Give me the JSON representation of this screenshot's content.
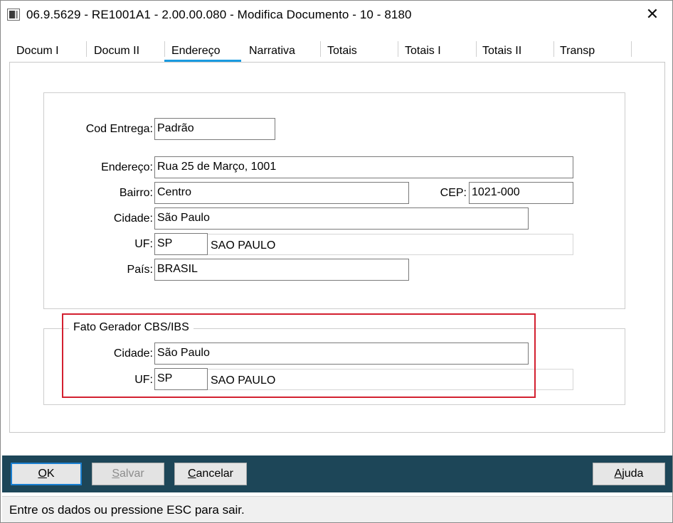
{
  "window": {
    "title": "06.9.5629 - RE1001A1 - 2.00.00.080 - Modifica Documento - 10 - 8180",
    "close_glyph": "✕",
    "icon": "app-window-icon"
  },
  "tabs": [
    {
      "label": "Docum I",
      "active": false
    },
    {
      "label": "Docum II",
      "active": false
    },
    {
      "label": "Endereço",
      "active": true
    },
    {
      "label": "Narrativa",
      "active": false
    },
    {
      "label": "Totais",
      "active": false
    },
    {
      "label": "Totais I",
      "active": false
    },
    {
      "label": "Totais II",
      "active": false
    },
    {
      "label": "Transp",
      "active": false
    }
  ],
  "address": {
    "cod_entrega_label": "Cod Entrega:",
    "cod_entrega_value": "Padrão",
    "endereco_label": "Endereço:",
    "endereco_value": "Rua 25 de Março, 1001",
    "bairro_label": "Bairro:",
    "bairro_value": "Centro",
    "cep_label": "CEP:",
    "cep_value": "1021-000",
    "cidade_label": "Cidade:",
    "cidade_value": "São Paulo",
    "uf_label": "UF:",
    "uf_value": "SP",
    "uf_description": "SAO PAULO",
    "pais_label": "País:",
    "pais_value": "BRASIL"
  },
  "fato_gerador": {
    "group_title": "Fato Gerador CBS/IBS",
    "cidade_label": "Cidade:",
    "cidade_value": "São Paulo",
    "uf_label": "UF:",
    "uf_value": "SP",
    "uf_description": "SAO PAULO"
  },
  "buttons": {
    "ok": {
      "mnemonic": "O",
      "rest": "K"
    },
    "salvar": {
      "mnemonic": "S",
      "rest": "alvar",
      "enabled": false
    },
    "cancelar": {
      "mnemonic": "C",
      "rest": "ancelar"
    },
    "ajuda": {
      "mnemonic": "A",
      "rest": "juda"
    }
  },
  "status": {
    "message": "Entre os dados ou pressione ESC para sair."
  },
  "colors": {
    "tab_accent": "#1a9be0",
    "button_bar": "#1d4658",
    "highlight": "#d32030"
  }
}
